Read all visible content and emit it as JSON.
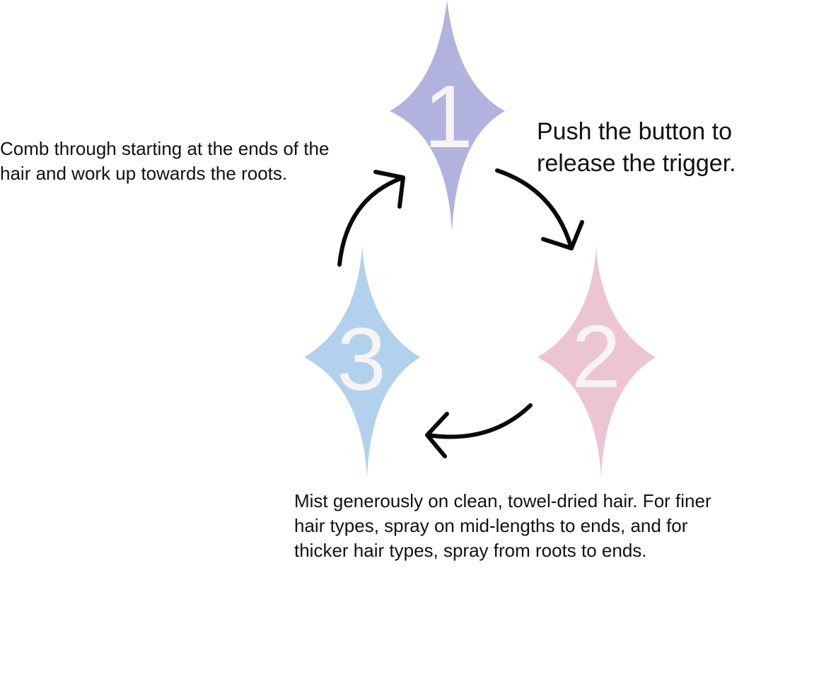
{
  "steps": [
    {
      "number": "1",
      "color": "#b1b2de",
      "text": "Push the button to\nrelease the trigger."
    },
    {
      "number": "2",
      "color": "#ecc5d4",
      "text": "Mist generously on clean, towel-dried hair. For finer\nhair types, spray on mid-lengths to ends, and for\nthicker hair types, spray from roots to ends."
    },
    {
      "number": "3",
      "color": "#b2d1ec",
      "text": "Comb through starting at the ends of the\nhair and work up towards the roots."
    }
  ]
}
